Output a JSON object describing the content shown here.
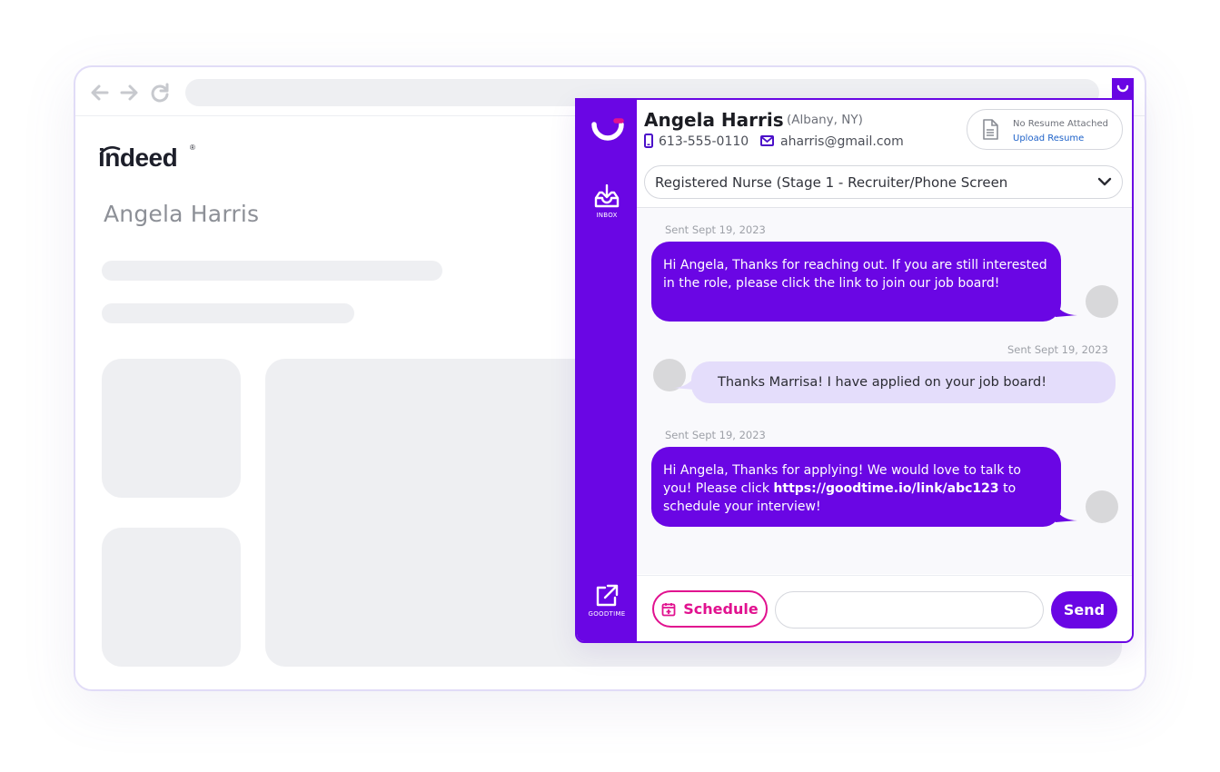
{
  "brand": {
    "primary": "#6a06e4",
    "accent": "#e1118f",
    "link": "#1e62c9"
  },
  "browser": {
    "nav_icons": [
      "arrow-left-icon",
      "arrow-right-icon",
      "reload-icon"
    ],
    "extension_icon": "goodtime-extension-icon"
  },
  "indeed": {
    "logo_text": "indeed",
    "registered": "®",
    "candidate_name": "Angela Harris"
  },
  "sidebar": {
    "logo_icon": "goodtime-logo-icon",
    "inbox_label": "INBOX",
    "goodtime_label": "GOODTIME"
  },
  "candidate": {
    "name": "Angela Harris",
    "location": "(Albany, NY)",
    "phone": "613-555-0110",
    "email": "aharris@gmail.com"
  },
  "resume": {
    "status": "No Resume Attached",
    "upload_label": "Upload Resume"
  },
  "job": {
    "selected": "Registered Nurse (Stage 1 - Recruiter/Phone Screen"
  },
  "messages": [
    {
      "direction": "outgoing",
      "timestamp": "Sent Sept 19, 2023",
      "text": "Hi Angela, Thanks for reaching out.  If you are still interested in the role, please click the link to join our job board!"
    },
    {
      "direction": "incoming",
      "timestamp": "Sent Sept 19, 2023",
      "text": "Thanks Marrisa! I have applied on your job board!"
    },
    {
      "direction": "outgoing",
      "timestamp": "Sent Sept 19, 2023",
      "text_before": "Hi Angela, Thanks for applying! We would love to talk to you! Please click ",
      "link": "https://goodtime.io/link/abc123",
      "text_after": " to schedule your interview!"
    }
  ],
  "composer": {
    "schedule_label": "Schedule",
    "input_placeholder": "",
    "send_label": "Send"
  }
}
